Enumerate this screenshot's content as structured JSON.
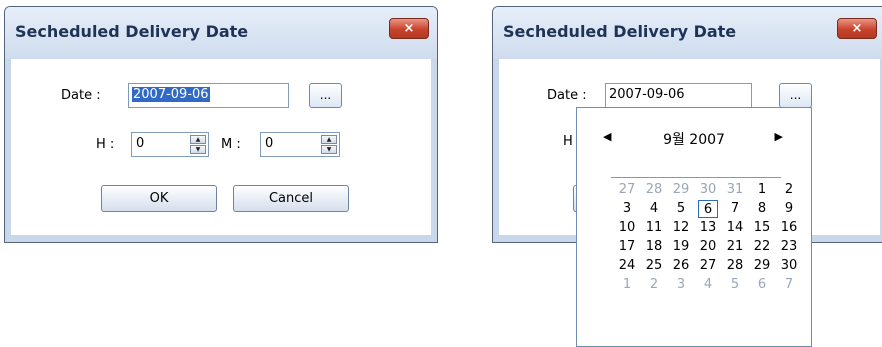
{
  "dialog_left": {
    "title": "Secheduled Delivery Date",
    "close_icon": "×",
    "date_label": "Date :",
    "date_value": "2007-09-06",
    "picker_button": "...",
    "hour_label": "H :",
    "hour_value": "0",
    "minute_label": "M :",
    "minute_value": "0",
    "ok_label": "OK",
    "cancel_label": "Cancel"
  },
  "dialog_right": {
    "title": "Secheduled Delivery Date",
    "close_icon": "×",
    "date_label": "Date :",
    "date_value": "2007-09-06",
    "picker_button": "...",
    "hour_label_partial": "H"
  },
  "calendar": {
    "prev_icon": "◀",
    "next_icon": "▶",
    "month_title": "9월 2007",
    "selected_day": "6",
    "weeks": [
      [
        {
          "d": "27",
          "o": true
        },
        {
          "d": "28",
          "o": true
        },
        {
          "d": "29",
          "o": true
        },
        {
          "d": "30",
          "o": true
        },
        {
          "d": "31",
          "o": true
        },
        {
          "d": "1",
          "o": false
        },
        {
          "d": "2",
          "o": false
        }
      ],
      [
        {
          "d": "3",
          "o": false
        },
        {
          "d": "4",
          "o": false
        },
        {
          "d": "5",
          "o": false
        },
        {
          "d": "6",
          "o": false
        },
        {
          "d": "7",
          "o": false
        },
        {
          "d": "8",
          "o": false
        },
        {
          "d": "9",
          "o": false
        }
      ],
      [
        {
          "d": "10",
          "o": false
        },
        {
          "d": "11",
          "o": false
        },
        {
          "d": "12",
          "o": false
        },
        {
          "d": "13",
          "o": false
        },
        {
          "d": "14",
          "o": false
        },
        {
          "d": "15",
          "o": false
        },
        {
          "d": "16",
          "o": false
        }
      ],
      [
        {
          "d": "17",
          "o": false
        },
        {
          "d": "18",
          "o": false
        },
        {
          "d": "19",
          "o": false
        },
        {
          "d": "20",
          "o": false
        },
        {
          "d": "21",
          "o": false
        },
        {
          "d": "22",
          "o": false
        },
        {
          "d": "23",
          "o": false
        }
      ],
      [
        {
          "d": "24",
          "o": false
        },
        {
          "d": "25",
          "o": false
        },
        {
          "d": "26",
          "o": false
        },
        {
          "d": "27",
          "o": false
        },
        {
          "d": "28",
          "o": false
        },
        {
          "d": "29",
          "o": false
        },
        {
          "d": "30",
          "o": false
        }
      ],
      [
        {
          "d": "1",
          "o": true
        },
        {
          "d": "2",
          "o": true
        },
        {
          "d": "3",
          "o": true
        },
        {
          "d": "4",
          "o": true
        },
        {
          "d": "5",
          "o": true
        },
        {
          "d": "6",
          "o": true
        },
        {
          "d": "7",
          "o": true
        }
      ]
    ]
  }
}
